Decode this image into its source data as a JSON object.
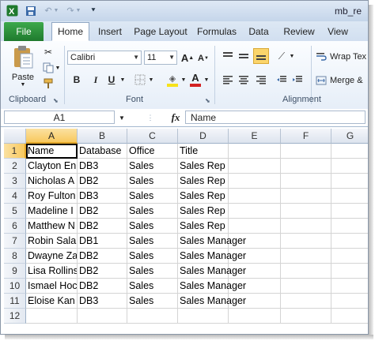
{
  "titlebar": {
    "title": "mb_re"
  },
  "tabs": {
    "file": "File",
    "items": [
      "Home",
      "Insert",
      "Page Layout",
      "Formulas",
      "Data",
      "Review",
      "View"
    ]
  },
  "ribbon": {
    "clipboard": {
      "paste": "Paste",
      "label": "Clipboard"
    },
    "font": {
      "name": "Calibri",
      "size": "11",
      "label": "Font",
      "bold": "B",
      "italic": "I",
      "underline": "U",
      "grow": "A",
      "shrink": "A",
      "color_a": "A"
    },
    "alignment": {
      "wrap": "Wrap Tex",
      "merge": "Merge &",
      "label": "Alignment"
    },
    "colors": {
      "fill": "#f7e21b",
      "font_color": "#d32222",
      "active_align": "#fbd56b"
    }
  },
  "formula_bar": {
    "cell_ref": "A1",
    "fx": "fx",
    "content": "Name"
  },
  "columns": [
    "A",
    "B",
    "C",
    "D",
    "E",
    "F",
    "G"
  ],
  "rows": [
    "1",
    "2",
    "3",
    "4",
    "5",
    "6",
    "7",
    "8",
    "9",
    "10",
    "11",
    "12"
  ],
  "cells": [
    [
      "Name",
      "Database",
      "Office",
      "Title"
    ],
    [
      "Clayton En",
      "DB3",
      "Sales",
      "Sales Rep"
    ],
    [
      "Nicholas A",
      "DB2",
      "Sales",
      "Sales Rep"
    ],
    [
      "Roy Fulton",
      "DB3",
      "Sales",
      "Sales Rep"
    ],
    [
      "Madeline I",
      "DB2",
      "Sales",
      "Sales Rep"
    ],
    [
      "Matthew N",
      "DB2",
      "Sales",
      "Sales Rep"
    ],
    [
      "Robin Sala",
      "DB1",
      "Sales",
      "Sales Manager"
    ],
    [
      "Dwayne Za",
      "DB2",
      "Sales",
      "Sales Manager"
    ],
    [
      "Lisa Rollins",
      "DB2",
      "Sales",
      "Sales Manager"
    ],
    [
      "Ismael Hoc",
      "DB2",
      "Sales",
      "Sales Manager"
    ],
    [
      "Eloise Kan",
      "DB3",
      "Sales",
      "Sales Manager"
    ]
  ]
}
